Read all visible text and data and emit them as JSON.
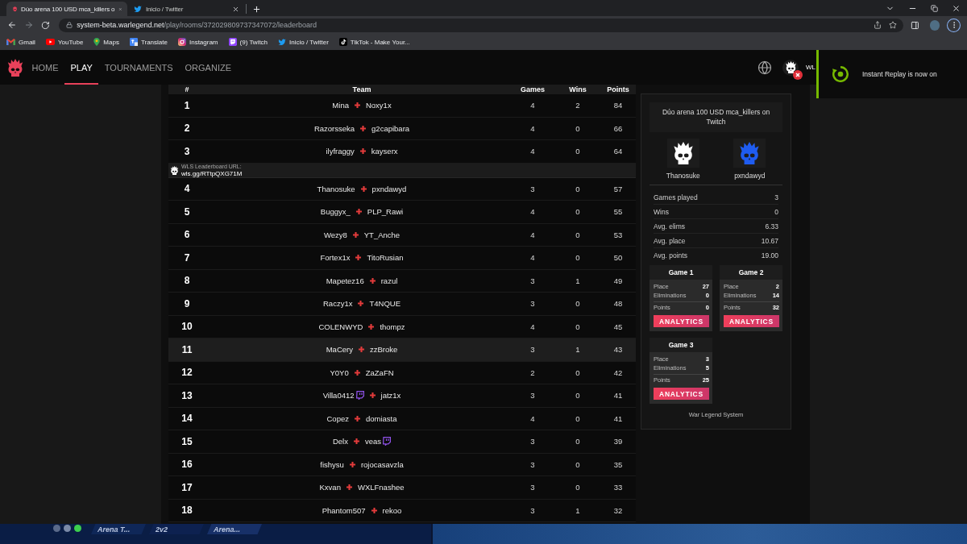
{
  "browser": {
    "tabs": [
      {
        "title": "Dúo arena 100 USD mca_killers o",
        "kind": "skull",
        "selected": true
      },
      {
        "title": "Inicio / Twitter",
        "kind": "bird",
        "selected": false
      }
    ],
    "url": {
      "host": "system-beta.warlegend.net",
      "path": "/play/rooms/372029809737347072/leaderboard"
    },
    "bookmarks": [
      {
        "label": "Gmail",
        "kind": "mail"
      },
      {
        "label": "YouTube",
        "kind": "video"
      },
      {
        "label": "Maps",
        "kind": "map"
      },
      {
        "label": "Translate",
        "kind": "translate"
      },
      {
        "label": "Instagram",
        "kind": "camera"
      },
      {
        "label": "(9) Twitch",
        "kind": "stream"
      },
      {
        "label": "Inicio / Twitter",
        "kind": "bird"
      },
      {
        "label": "TikTok - Make Your...",
        "kind": "note"
      }
    ]
  },
  "nav": {
    "items": [
      {
        "label": "HOME",
        "selected": false
      },
      {
        "label": "PLAY",
        "selected": true
      },
      {
        "label": "TOURNAMENTS",
        "selected": false
      },
      {
        "label": "ORGANIZE",
        "selected": false
      }
    ],
    "user_label": "WL"
  },
  "notification": {
    "text": "Instant Replay is now on"
  },
  "leaderboard": {
    "columns": [
      "#",
      "Team",
      "Games",
      "Wins",
      "Points"
    ],
    "rows": [
      {
        "kind": "team",
        "rank": "1",
        "players": [
          {
            "name": "Mina",
            "twitch": false
          },
          {
            "name": "Noxy1x",
            "twitch": false
          }
        ],
        "games": "4",
        "wins": "2",
        "points": "84",
        "hovered": false
      },
      {
        "kind": "team",
        "rank": "2",
        "players": [
          {
            "name": "Razorsseka",
            "twitch": false
          },
          {
            "name": "g2capibara",
            "twitch": false
          }
        ],
        "games": "4",
        "wins": "0",
        "points": "66",
        "hovered": false
      },
      {
        "kind": "team",
        "rank": "3",
        "players": [
          {
            "name": "ilyfraggy",
            "twitch": false
          },
          {
            "name": "kayserx",
            "twitch": false
          }
        ],
        "games": "4",
        "wins": "0",
        "points": "64",
        "hovered": false
      },
      {
        "kind": "link",
        "label": "WLS Leaderboard URL:",
        "url": "wls.gg/RTtpQXG71M"
      },
      {
        "kind": "team",
        "rank": "4",
        "players": [
          {
            "name": "Thanosuke",
            "twitch": false
          },
          {
            "name": "pxndawyd",
            "twitch": false
          }
        ],
        "games": "3",
        "wins": "0",
        "points": "57",
        "hovered": false
      },
      {
        "kind": "team",
        "rank": "5",
        "players": [
          {
            "name": "Buggyx_",
            "twitch": false
          },
          {
            "name": "PLP_Rawi",
            "twitch": false
          }
        ],
        "games": "4",
        "wins": "0",
        "points": "55",
        "hovered": false
      },
      {
        "kind": "team",
        "rank": "6",
        "players": [
          {
            "name": "Wezy8",
            "twitch": false
          },
          {
            "name": "YT_Anche",
            "twitch": false
          }
        ],
        "games": "4",
        "wins": "0",
        "points": "53",
        "hovered": false
      },
      {
        "kind": "team",
        "rank": "7",
        "players": [
          {
            "name": "Fortex1x",
            "twitch": false
          },
          {
            "name": "TitoRusian",
            "twitch": false
          }
        ],
        "games": "4",
        "wins": "0",
        "points": "50",
        "hovered": false
      },
      {
        "kind": "team",
        "rank": "8",
        "players": [
          {
            "name": "Mapetez16",
            "twitch": false
          },
          {
            "name": "razul",
            "twitch": false
          }
        ],
        "games": "3",
        "wins": "1",
        "points": "49",
        "hovered": false
      },
      {
        "kind": "team",
        "rank": "9",
        "players": [
          {
            "name": "Raczy1x",
            "twitch": false
          },
          {
            "name": "T4NQUE",
            "twitch": false
          }
        ],
        "games": "3",
        "wins": "0",
        "points": "48",
        "hovered": false
      },
      {
        "kind": "team",
        "rank": "10",
        "players": [
          {
            "name": "COLENWYD",
            "twitch": false
          },
          {
            "name": "thompz",
            "twitch": false
          }
        ],
        "games": "4",
        "wins": "0",
        "points": "45",
        "hovered": false
      },
      {
        "kind": "team",
        "rank": "11",
        "players": [
          {
            "name": "MaCery",
            "twitch": false
          },
          {
            "name": "zzBroke",
            "twitch": false
          }
        ],
        "games": "3",
        "wins": "1",
        "points": "43",
        "hovered": true
      },
      {
        "kind": "team",
        "rank": "12",
        "players": [
          {
            "name": "Y0Y0",
            "twitch": false
          },
          {
            "name": "ZaZaFN",
            "twitch": false
          }
        ],
        "games": "2",
        "wins": "0",
        "points": "42",
        "hovered": false
      },
      {
        "kind": "team",
        "rank": "13",
        "players": [
          {
            "name": "Villa0412",
            "twitch": true
          },
          {
            "name": "jatz1x",
            "twitch": false
          }
        ],
        "games": "3",
        "wins": "0",
        "points": "41",
        "hovered": false
      },
      {
        "kind": "team",
        "rank": "14",
        "players": [
          {
            "name": "Copez",
            "twitch": false
          },
          {
            "name": "domiasta",
            "twitch": false
          }
        ],
        "games": "4",
        "wins": "0",
        "points": "41",
        "hovered": false
      },
      {
        "kind": "team",
        "rank": "15",
        "players": [
          {
            "name": "Delx",
            "twitch": false
          },
          {
            "name": "veas",
            "twitch": true
          }
        ],
        "games": "3",
        "wins": "0",
        "points": "39",
        "hovered": false
      },
      {
        "kind": "team",
        "rank": "16",
        "players": [
          {
            "name": "fishysu",
            "twitch": false
          },
          {
            "name": "rojocasavzla",
            "twitch": false
          }
        ],
        "games": "3",
        "wins": "0",
        "points": "35",
        "hovered": false
      },
      {
        "kind": "team",
        "rank": "17",
        "players": [
          {
            "name": "Kxvan",
            "twitch": false
          },
          {
            "name": "WXLFnashee",
            "twitch": false
          }
        ],
        "games": "3",
        "wins": "0",
        "points": "33",
        "hovered": false
      },
      {
        "kind": "team",
        "rank": "18",
        "players": [
          {
            "name": "Phantom507",
            "twitch": false
          },
          {
            "name": "rekoo",
            "twitch": false
          }
        ],
        "games": "3",
        "wins": "1",
        "points": "32",
        "hovered": false
      }
    ]
  },
  "team_panel": {
    "title": "Dúo arena 100 USD mca_killers on Twitch",
    "players": [
      {
        "name": "Thanosuke",
        "color": "#ffffff"
      },
      {
        "name": "pxndawyd",
        "color": "#1f5cf0"
      }
    ],
    "stats": [
      {
        "label": "Games played",
        "value": "3"
      },
      {
        "label": "Wins",
        "value": "0"
      },
      {
        "label": "Avg. elims",
        "value": "6.33"
      },
      {
        "label": "Avg. place",
        "value": "10.67"
      },
      {
        "label": "Avg. points",
        "value": "19.00"
      }
    ],
    "games": [
      {
        "title": "Game 1",
        "stats": [
          {
            "label": "Place",
            "value": "27"
          },
          {
            "label": "Eliminations",
            "value": "0"
          },
          {
            "label": "Points",
            "value": "0"
          }
        ],
        "button": "ANALYTICS"
      },
      {
        "title": "Game 2",
        "stats": [
          {
            "label": "Place",
            "value": "2"
          },
          {
            "label": "Eliminations",
            "value": "14"
          },
          {
            "label": "Points",
            "value": "32"
          }
        ],
        "button": "ANALYTICS"
      },
      {
        "title": "Game 3",
        "stats": [
          {
            "label": "Place",
            "value": "3"
          },
          {
            "label": "Eliminations",
            "value": "5"
          },
          {
            "label": "Points",
            "value": "25"
          }
        ],
        "button": "ANALYTICS"
      }
    ],
    "footer": "War Legend System"
  },
  "game_strip": {
    "tabs": [
      "Arena T...",
      "2v2",
      "Arena..."
    ]
  }
}
